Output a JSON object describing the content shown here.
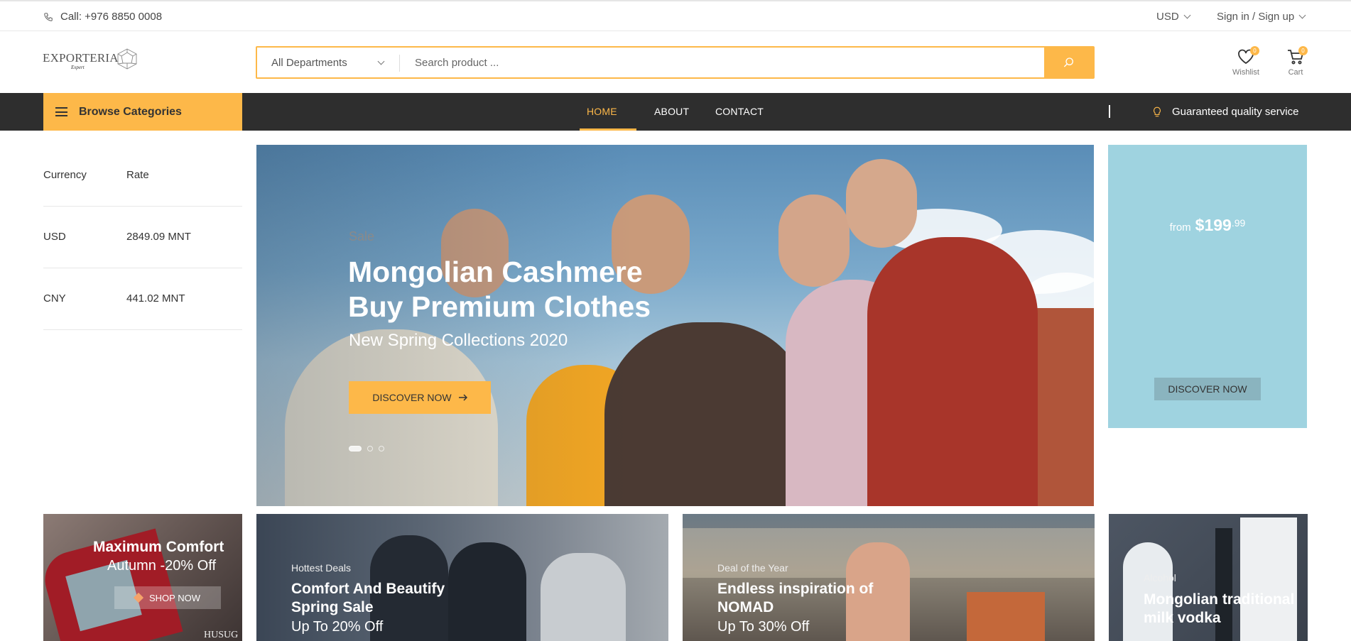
{
  "topbar": {
    "call": "Call: +976 8850 0008",
    "currency": "USD",
    "sign": "Sign in / Sign up"
  },
  "logo": {
    "word": "EXPORTERIA",
    "sub": "Expert"
  },
  "search": {
    "department": "All Departments",
    "placeholder": "Search product ..."
  },
  "header": {
    "wishlist_label": "Wishlist",
    "wishlist_count": "0",
    "cart_label": "Cart",
    "cart_count": "0"
  },
  "nav": {
    "browse": "Browse Categories",
    "items": [
      "HOME",
      "ABOUT",
      "CONTACT"
    ],
    "quality": "Guaranteed quality service"
  },
  "currency_table": {
    "headers": [
      "Currency",
      "Rate"
    ],
    "rows": [
      [
        "USD",
        "2849.09 MNT"
      ],
      [
        "CNY",
        "441.02 MNT"
      ]
    ]
  },
  "hero": {
    "tag": "Sale",
    "title_line1": "Mongolian Cashmere",
    "title_line2": "Buy Premium Clothes",
    "subtitle": "New Spring Collections 2020",
    "button": "DISCOVER NOW"
  },
  "promo": {
    "from": "from",
    "price": "$199",
    "cents": ".99",
    "button": "DISCOVER NOW"
  },
  "banners": [
    {
      "title1": "Maximum Comfort",
      "title2": "Autumn -20% Off",
      "button": "SHOP NOW",
      "brand": "HUSUG"
    },
    {
      "tag": "Hottest Deals",
      "title1": "Comfort And Beautify",
      "title2": "Spring Sale",
      "off": "Up To 20% Off"
    },
    {
      "tag": "Deal of the Year",
      "title1": "Endless inspiration of",
      "title2": "NOMAD",
      "off": "Up To 30% Off"
    },
    {
      "tag": "Alcohol",
      "title1": "Mongolian traditional",
      "title2": "milk vodka"
    }
  ],
  "colors": {
    "accent": "#fdb849",
    "navbar": "#2e2e2e",
    "promo": "#9fd3e0"
  }
}
